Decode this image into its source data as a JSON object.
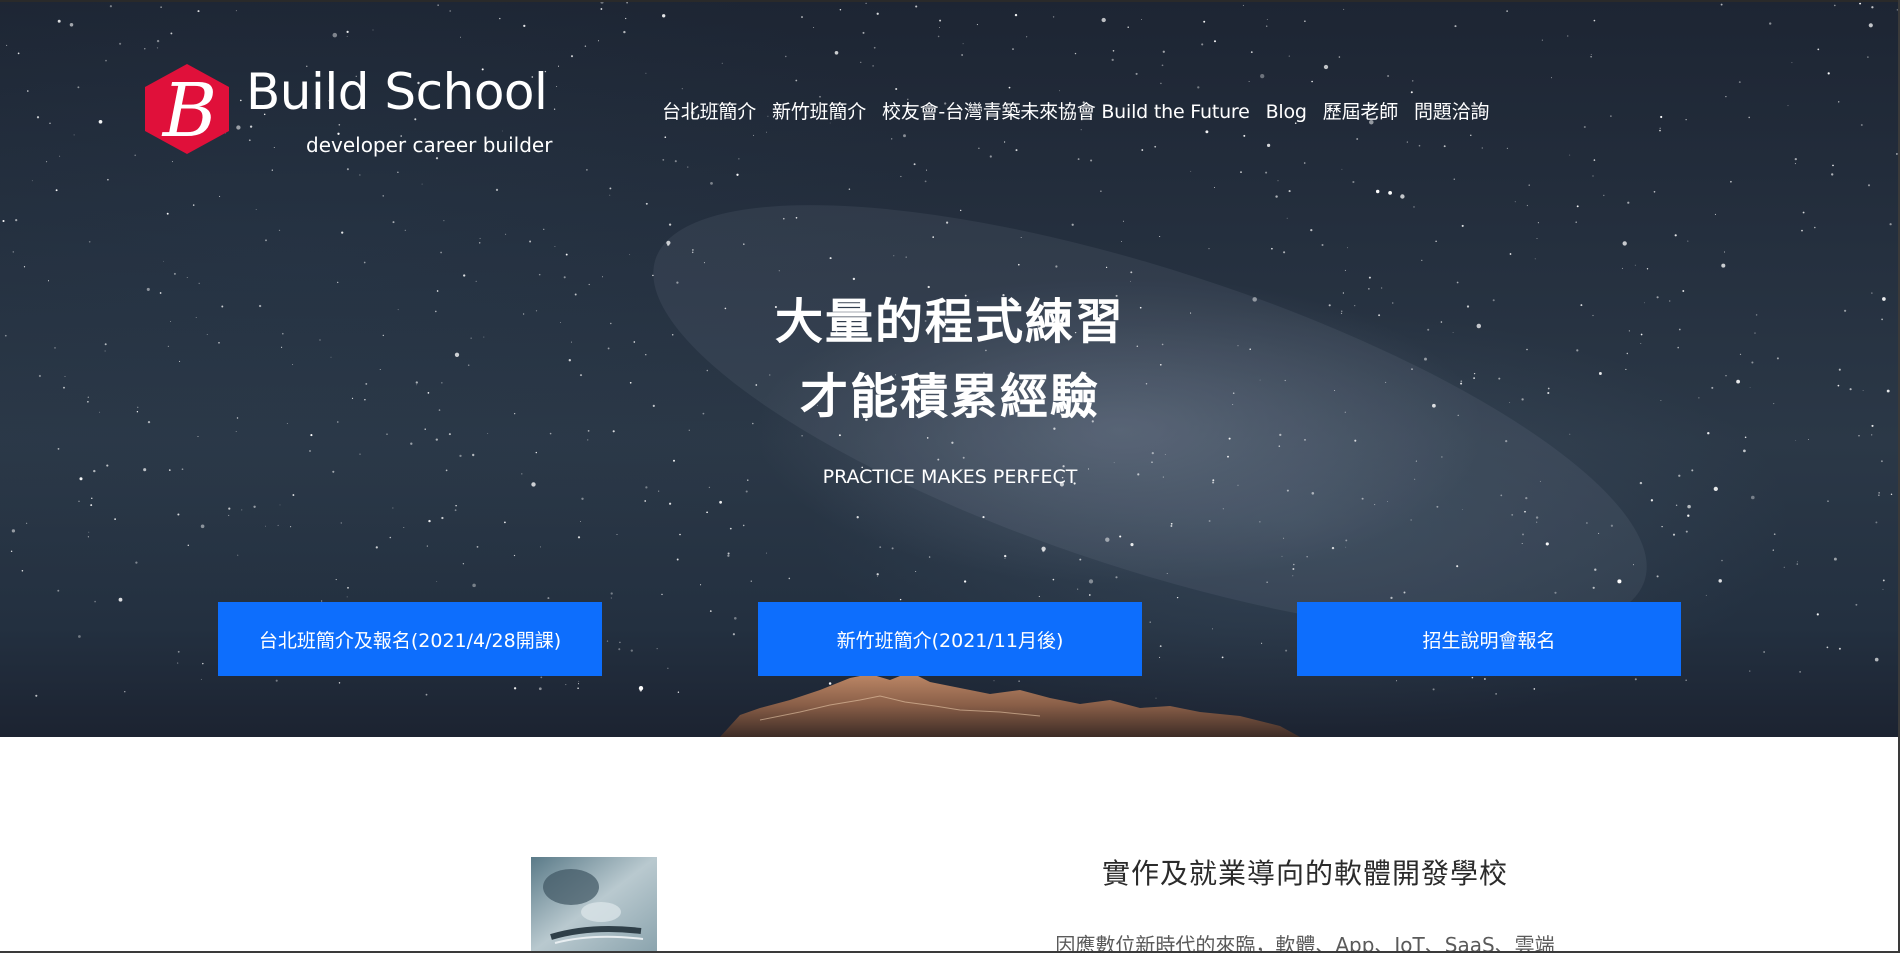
{
  "brand": {
    "logo_letter": "B",
    "name": "Build School",
    "tagline": "developer career builder",
    "accent_color": "#e0103a"
  },
  "nav": {
    "items": [
      {
        "label": "台北班簡介"
      },
      {
        "label": "新竹班簡介"
      },
      {
        "label": "校友會-台灣青築未來協會 Build the Future"
      },
      {
        "label": "Blog"
      },
      {
        "label": "歷屆老師"
      },
      {
        "label": "問題洽詢"
      }
    ]
  },
  "hero": {
    "headline_line1": "大量的程式練習",
    "headline_line2": "才能積累經驗",
    "subheadline": "PRACTICE MAKES PERFECT",
    "background": "night-sky-with-mountains",
    "buttons": [
      {
        "label": "台北班簡介及報名(2021/4/28開課)"
      },
      {
        "label": "新竹班簡介(2021/11月後)"
      },
      {
        "label": "招生說明會報名"
      }
    ],
    "button_color": "#0d6efd"
  },
  "intro": {
    "title": "實作及就業導向的軟體開發學校",
    "body_partial": "因應數位新時代的來臨，軟體、App、IoT、SaaS、雲端"
  }
}
